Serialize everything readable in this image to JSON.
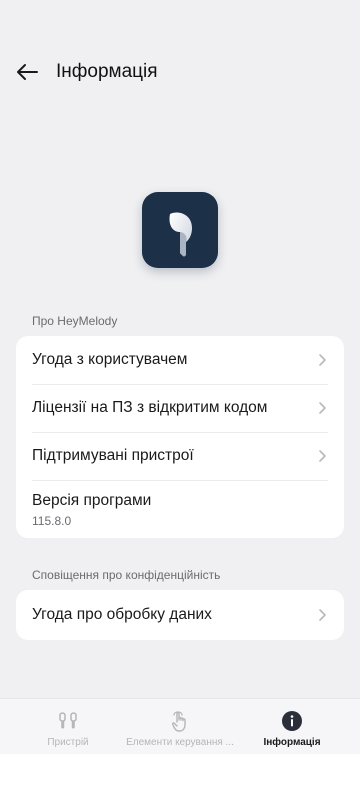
{
  "header": {
    "title": "Інформація"
  },
  "about_section": {
    "label": "Про HeyMelody",
    "items": [
      {
        "label": "Угода з користувачем"
      },
      {
        "label": "Ліцензії на ПЗ з відкритим кодом"
      },
      {
        "label": "Підтримувані пристрої"
      }
    ],
    "version": {
      "label": "Версія програми",
      "value": "115.8.0"
    }
  },
  "privacy_section": {
    "label": "Сповіщення про конфіденційність",
    "items": [
      {
        "label": "Угода про обробку даних"
      }
    ]
  },
  "bottom_nav": {
    "items": [
      {
        "label": "Пристрій",
        "icon": "earbuds-icon",
        "active": false
      },
      {
        "label": "Елементи керування ...",
        "icon": "touch-icon",
        "active": false
      },
      {
        "label": "Інформація",
        "icon": "info-icon",
        "active": true
      }
    ]
  },
  "colors": {
    "background": "#f0f0f2",
    "card": "#ffffff",
    "app_icon_bg": "#1c3047",
    "active_nav": "#2a2f3a",
    "inactive_nav": "#b5b5ba"
  }
}
